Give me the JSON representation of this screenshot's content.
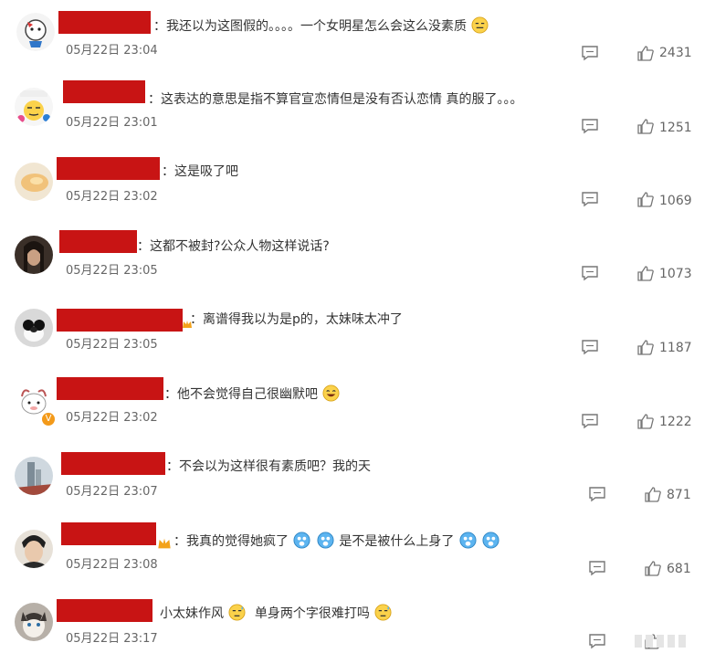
{
  "comments": [
    {
      "text": "：我还以为这图假的。。。。一个女明星怎么会这么没素质",
      "time": "05月22日 23:04",
      "likes": "2431",
      "emoji_after": "awkward"
    },
    {
      "text": "：这表达的意思是指不算官宣恋情但是没有否认恋情 真的服了。。。",
      "time": "05月22日 23:01",
      "likes": "1251"
    },
    {
      "text": "：这是吸了吧",
      "time": "05月22日 23:02",
      "likes": "1069"
    },
    {
      "text": "：这都不被封?公众人物这样说话?",
      "time": "05月22日 23:05",
      "likes": "1073"
    },
    {
      "text": "：离谱得我以为是p的，太妹味太冲了",
      "time": "05月22日 23:05",
      "likes": "1187"
    },
    {
      "text": "：他不会觉得自己很幽默吧",
      "time": "05月22日 23:02",
      "likes": "1222",
      "emoji_after": "laugh"
    },
    {
      "text": "：不会以为这样很有素质吧？我的天",
      "time": "05月22日 23:07",
      "likes": "871"
    },
    {
      "text_a": "：我真的觉得她疯了",
      "text_b": "是不是被什么上身了",
      "time": "05月22日 23:08",
      "likes": "681"
    },
    {
      "text_a": "小太妹作风",
      "text_b": "单身两个字很难打吗",
      "time": "05月22日 23:17",
      "likes": ""
    }
  ],
  "icons": {
    "reply": "reply-icon",
    "like": "thumbs-up-icon",
    "redaction_color": "#c81414",
    "badge_color": "#f39a1a"
  }
}
